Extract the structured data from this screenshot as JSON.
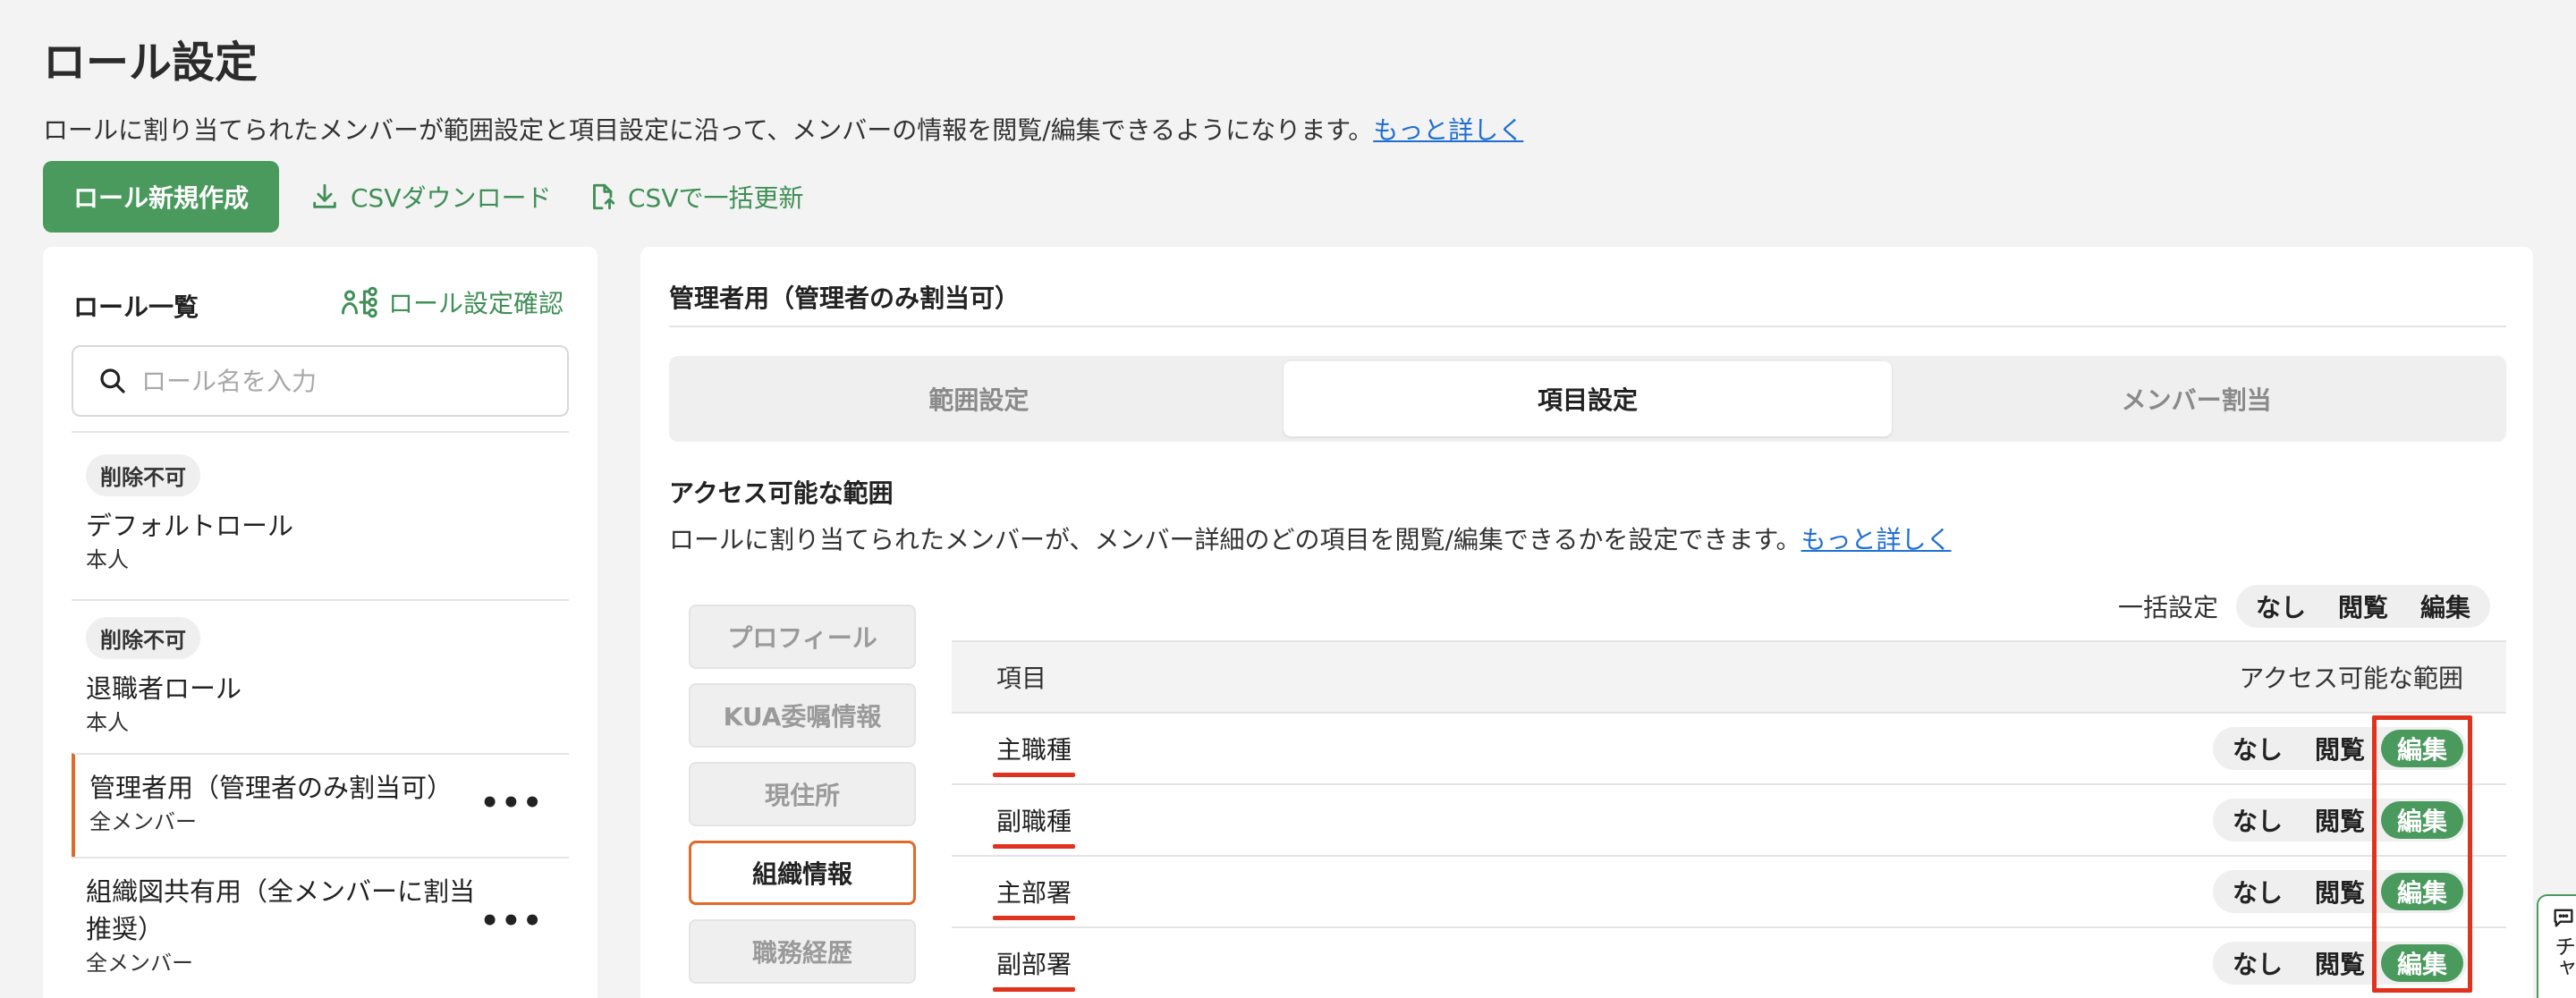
{
  "page": {
    "title": "ロール設定",
    "description": "ロールに割り当てられたメンバーが範囲設定と項目設定に沿って、メンバーの情報を閲覧/編集できるようになります。",
    "more_link": "もっと詳しく"
  },
  "toolbar": {
    "create_label": "ロール新規作成",
    "csv_download_label": "CSVダウンロード",
    "csv_bulk_update_label": "CSVで一括更新"
  },
  "role_list": {
    "title": "ロール一覧",
    "check_link": "ロール設定確認",
    "search_placeholder": "ロール名を入力",
    "items": [
      {
        "badge": "削除不可",
        "name": "デフォルトロール",
        "scope": "本人"
      },
      {
        "badge": "削除不可",
        "name": "退職者ロール",
        "scope": "本人"
      },
      {
        "name": "管理者用（管理者のみ割当可）",
        "scope": "全メンバー",
        "more": "•••"
      },
      {
        "name": "組織図共有用（全メンバーに割当推奨）",
        "scope": "全メンバー",
        "more": "•••"
      }
    ]
  },
  "detail": {
    "role_title": "管理者用（管理者のみ割当可）",
    "tabs": [
      "範囲設定",
      "項目設定",
      "メンバー割当"
    ],
    "active_tab": "項目設定",
    "section_title": "アクセス可能な範囲",
    "section_desc": "ロールに割り当てられたメンバーが、メンバー詳細のどの項目を閲覧/編集できるかを設定できます。",
    "section_more_link": "もっと詳しく",
    "categories": [
      "プロフィール",
      "KUA委嘱情報",
      "現住所",
      "組織情報",
      "職務経歴"
    ],
    "active_category": "組織情報",
    "bulk_label": "一括設定",
    "options": [
      "なし",
      "閲覧",
      "編集"
    ],
    "table": {
      "col_item": "項目",
      "col_access": "アクセス可能な範囲",
      "rows": [
        {
          "item": "主職種",
          "selected": "編集"
        },
        {
          "item": "副職種",
          "selected": "編集"
        },
        {
          "item": "主部署",
          "selected": "編集"
        },
        {
          "item": "副部署",
          "selected": "編集"
        }
      ]
    }
  },
  "chat_tab": {
    "label": "チャ"
  },
  "colors": {
    "accent_green": "#4a9a5e",
    "selected_orange": "#e06a2a",
    "highlight_red": "#e0321c",
    "link_blue": "#1f6fd1"
  }
}
